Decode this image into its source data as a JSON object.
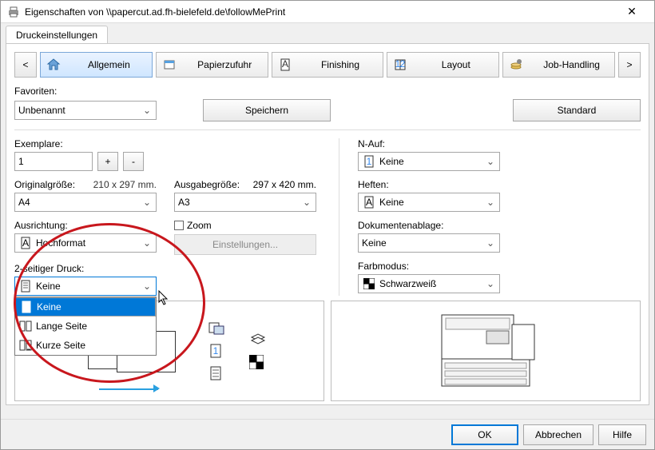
{
  "window": {
    "title": "Eigenschaften von \\\\papercut.ad.fh-bielefeld.de\\followMePrint",
    "close": "✕"
  },
  "tab": {
    "label": "Druckeinstellungen"
  },
  "nav": {
    "prev": "<",
    "next": ">",
    "items": [
      {
        "label": "Allgemein",
        "icon": "home"
      },
      {
        "label": "Papierzufuhr",
        "icon": "tray"
      },
      {
        "label": "Finishing",
        "icon": "doc-a"
      },
      {
        "label": "Layout",
        "icon": "grid12"
      },
      {
        "label": "Job-Handling",
        "icon": "stack-gear"
      }
    ],
    "active_index": 0
  },
  "favorites": {
    "label": "Favoriten:",
    "value": "Unbenannt",
    "save": "Speichern",
    "defaults": "Standard"
  },
  "left": {
    "copies_label": "Exemplare:",
    "copies_value": "1",
    "plus": "+",
    "minus": "-",
    "origsize_label": "Originalgröße:",
    "origsize_dim": "210 x 297 mm.",
    "origsize_value": "A4",
    "orientation_label": "Ausrichtung:",
    "orientation_value": "Hochformat",
    "duplex_label": "2-seitiger Druck:",
    "duplex_value": "Keine",
    "duplex_options": [
      "Keine",
      "Lange Seite",
      "Kurze Seite"
    ],
    "duplex_selected_index": 0
  },
  "mid": {
    "outsize_label": "Ausgabegröße:",
    "outsize_dim": "297 x 420 mm.",
    "outsize_value": "A3",
    "zoom_label": "Zoom",
    "zoom_btn": "Einstellungen..."
  },
  "right": {
    "nup_label": "N-Auf:",
    "nup_value": "Keine",
    "staple_label": "Heften:",
    "staple_value": "Keine",
    "docfile_label": "Dokumentenablage:",
    "docfile_value": "Keine",
    "color_label": "Farbmodus:",
    "color_value": "Schwarzweiß"
  },
  "footer": {
    "ok": "OK",
    "cancel": "Abbrechen",
    "help": "Hilfe"
  }
}
